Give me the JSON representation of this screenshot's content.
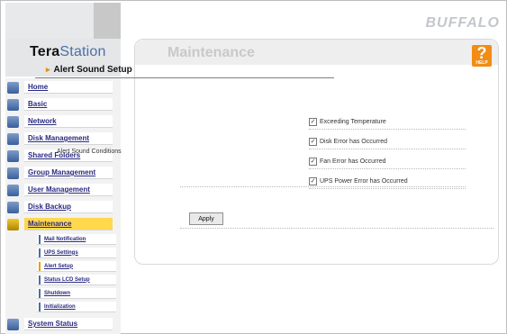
{
  "header": {
    "logo_tera": "Tera",
    "logo_station": "Station",
    "brand": "BUFFALO"
  },
  "content": {
    "title": "Maintenance",
    "help": {
      "q": "?",
      "label": "HELP"
    },
    "section_title": "Alert Sound Setup",
    "conditions_label": "Alert Sound Conditions",
    "options": [
      {
        "label": "Exceeding Temperature",
        "checked": true
      },
      {
        "label": "Disk Error has Occurred",
        "checked": true
      },
      {
        "label": "Fan Error has Occurred",
        "checked": true
      },
      {
        "label": "UPS Power Error has Occurred",
        "checked": true
      }
    ],
    "apply_label": "Apply"
  },
  "sidebar": {
    "items": [
      {
        "label": "Home"
      },
      {
        "label": "Basic"
      },
      {
        "label": "Network"
      },
      {
        "label": "Disk Management"
      },
      {
        "label": "Shared Folders"
      },
      {
        "label": "Group Management"
      },
      {
        "label": "User Management"
      },
      {
        "label": "Disk Backup"
      },
      {
        "label": "Maintenance",
        "active": true
      },
      {
        "label": "System Status"
      }
    ],
    "subitems": [
      {
        "label": "Mail Notification"
      },
      {
        "label": "UPS Settings"
      },
      {
        "label": "Alert Setup",
        "active": true
      },
      {
        "label": "Status LCD Setup"
      },
      {
        "label": "Shutdown"
      },
      {
        "label": "Initialization"
      }
    ]
  },
  "colors": {
    "accent_orange": "#f28c14",
    "active_tab": "#ffd84d",
    "nav_text": "#2a2a80"
  }
}
